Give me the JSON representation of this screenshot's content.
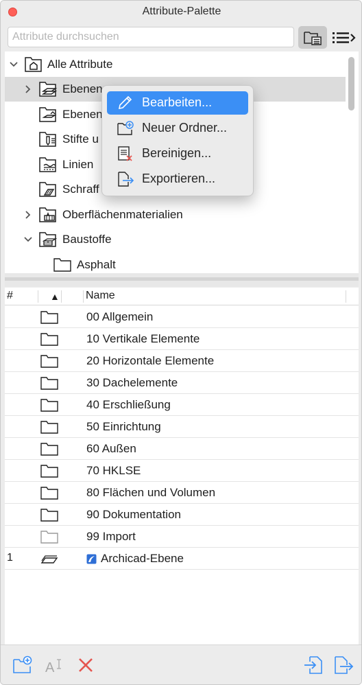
{
  "window": {
    "title": "Attribute-Palette",
    "accent": "#3b8ff5"
  },
  "search": {
    "placeholder": "Attribute durchsuchen",
    "value": ""
  },
  "toolbar": {
    "view_icon": "folder-list-icon",
    "menu_icon": "list-menu-icon"
  },
  "tree": {
    "root_label": "Alle Attribute",
    "items": [
      {
        "label": "Ebenen",
        "expandable": true,
        "expanded": false,
        "selected": true,
        "icon": "layers-folder-icon"
      },
      {
        "label": "Ebenenkombinationen",
        "visible_label": "Ebenen",
        "icon": "layer-combination-folder-icon"
      },
      {
        "label": "Stifte u",
        "icon": "pens-folder-icon"
      },
      {
        "label": "Linien",
        "icon": "lines-folder-icon"
      },
      {
        "label": "Schraff",
        "icon": "fills-folder-icon"
      },
      {
        "label": "Oberflächenmaterialien",
        "expandable": true,
        "expanded": false,
        "icon": "surfaces-folder-icon"
      },
      {
        "label": "Baustoffe",
        "expandable": true,
        "expanded": true,
        "icon": "materials-folder-icon"
      },
      {
        "label": "Asphalt",
        "icon": "folder-icon"
      }
    ]
  },
  "context_menu": {
    "items": [
      {
        "label": "Bearbeiten...",
        "icon": "pencil-icon",
        "active": true
      },
      {
        "label": "Neuer Ordner...",
        "icon": "new-folder-icon"
      },
      {
        "label": "Bereinigen...",
        "icon": "purge-icon"
      },
      {
        "label": "Exportieren...",
        "icon": "export-icon"
      }
    ]
  },
  "table": {
    "columns": {
      "num": "#",
      "sort": "▲",
      "name": "Name"
    },
    "rows": [
      {
        "num": "",
        "name": "00 Allgemein",
        "type": "folder"
      },
      {
        "num": "",
        "name": "10 Vertikale Elemente",
        "type": "folder"
      },
      {
        "num": "",
        "name": "20 Horizontale Elemente",
        "type": "folder"
      },
      {
        "num": "",
        "name": "30 Dachelemente",
        "type": "folder"
      },
      {
        "num": "",
        "name": "40 Erschließung",
        "type": "folder"
      },
      {
        "num": "",
        "name": "50 Einrichtung",
        "type": "folder"
      },
      {
        "num": "",
        "name": "60 Außen",
        "type": "folder"
      },
      {
        "num": "",
        "name": "70 HKLSE",
        "type": "folder"
      },
      {
        "num": "",
        "name": "80 Flächen und Volumen",
        "type": "folder"
      },
      {
        "num": "",
        "name": "90 Dokumentation",
        "type": "folder"
      },
      {
        "num": "",
        "name": "99 Import",
        "type": "folder-light"
      },
      {
        "num": "1",
        "name": "Archicad-Ebene",
        "type": "layer"
      }
    ]
  },
  "bottom_toolbar": {
    "left": [
      "new-folder-icon",
      "rename-icon",
      "delete-icon"
    ],
    "right": [
      "import-icon",
      "export-icon"
    ],
    "delete_color": "#e5554f",
    "import_export_color": "#3b8ff5"
  }
}
